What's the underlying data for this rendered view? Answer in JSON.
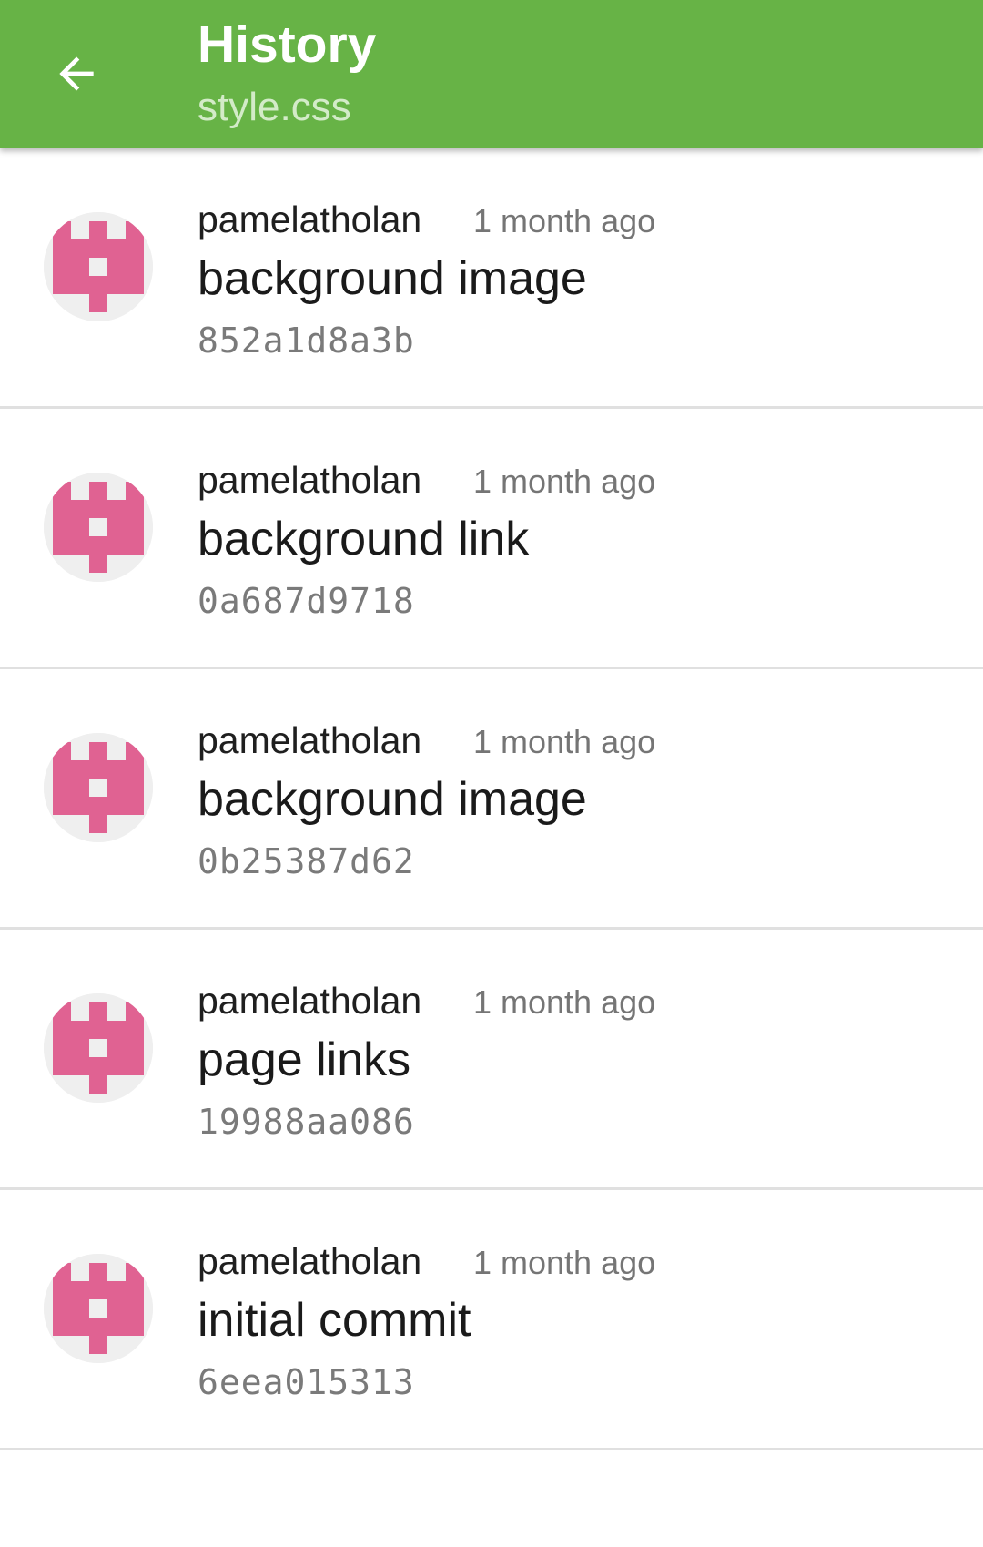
{
  "app_bar": {
    "back_icon": "arrow-left-icon",
    "title": "History",
    "subtitle": "style.css",
    "color": "#67b346"
  },
  "avatar": {
    "icon": "identicon-avatar-icon",
    "color": "#e06292",
    "background": "#efefef"
  },
  "commits": [
    {
      "author": "pamelatholan",
      "time": "1 month ago",
      "message": "background image",
      "hash": "852a1d8a3b"
    },
    {
      "author": "pamelatholan",
      "time": "1 month ago",
      "message": "background link",
      "hash": "0a687d9718"
    },
    {
      "author": "pamelatholan",
      "time": "1 month ago",
      "message": "background image",
      "hash": "0b25387d62"
    },
    {
      "author": "pamelatholan",
      "time": "1 month ago",
      "message": "page links",
      "hash": "19988aa086"
    },
    {
      "author": "pamelatholan",
      "time": "1 month ago",
      "message": "initial commit",
      "hash": "6eea015313"
    }
  ]
}
